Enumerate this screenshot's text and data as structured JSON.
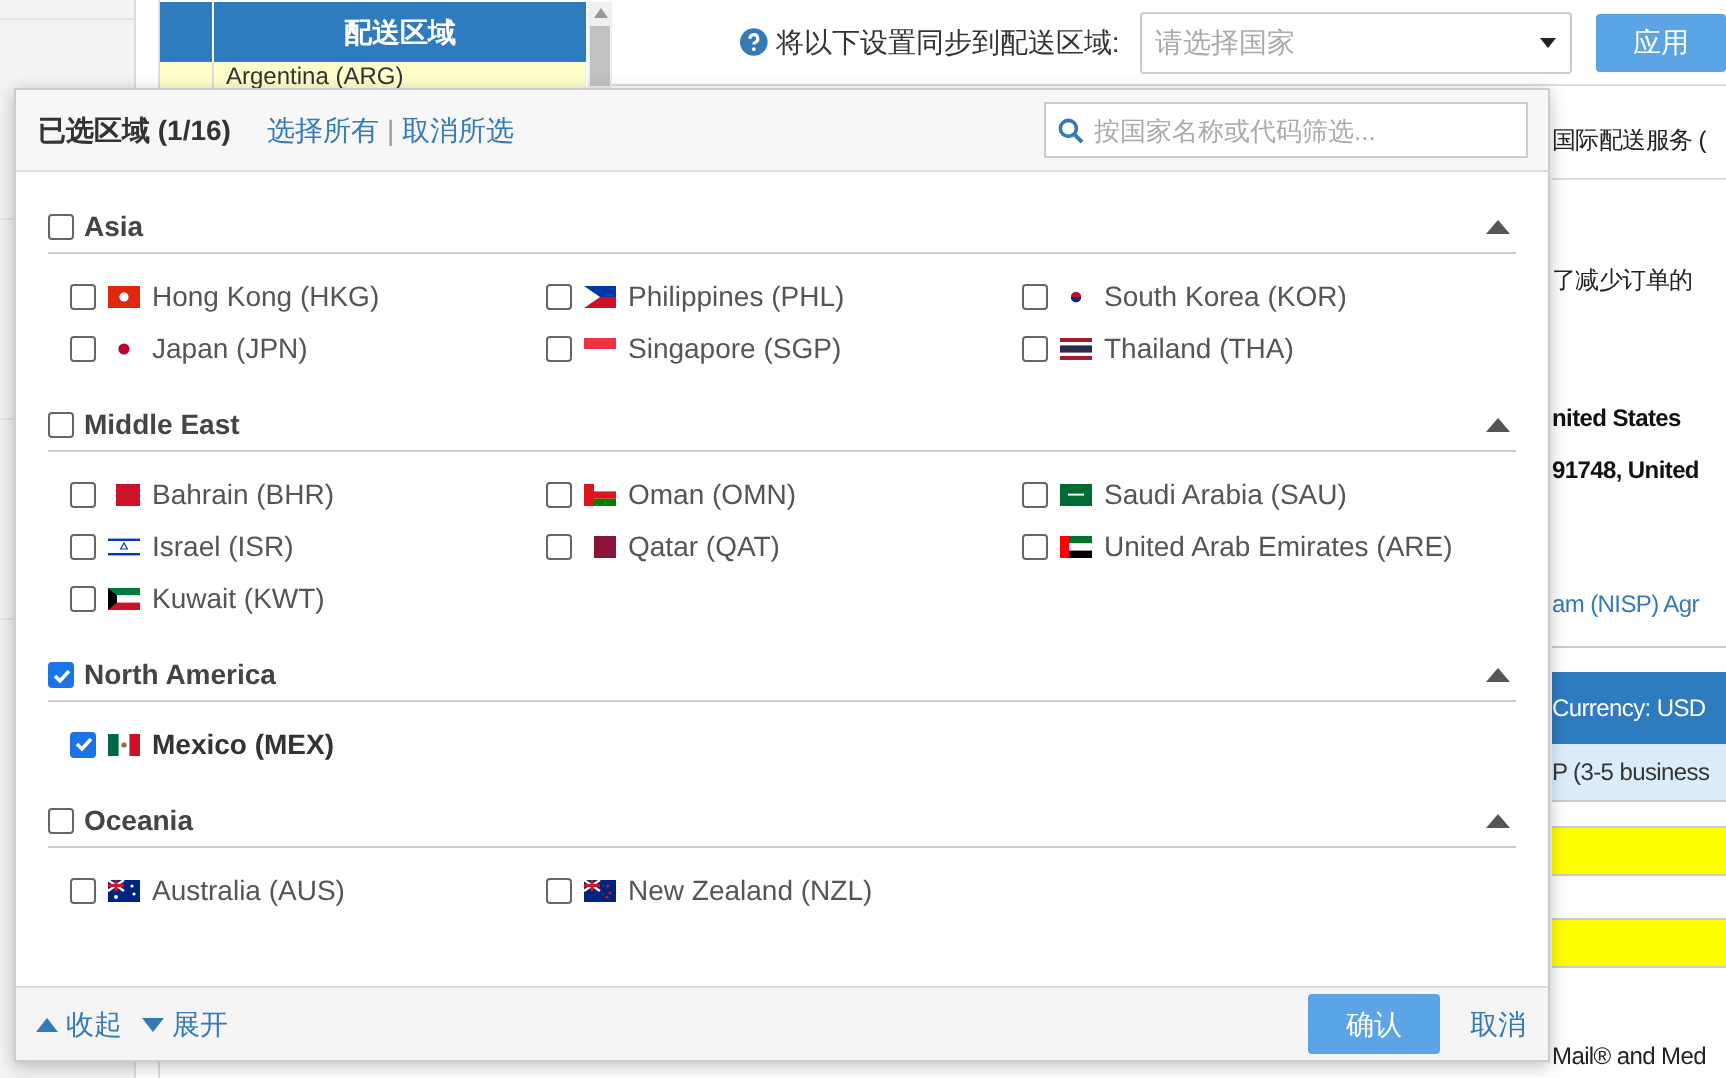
{
  "page": {
    "table_header": "配送区域",
    "table_row": "Argentina (ARG)",
    "sync_label": "将以下设置同步到配送区域:",
    "country_select": {
      "placeholder": "请选择国家"
    },
    "apply_button": "应用",
    "right_items": [
      {
        "kind": "text",
        "text": "国际配送服务 ("
      },
      {
        "kind": "text",
        "text": "了减少订单的"
      },
      {
        "kind": "bold",
        "text": "nited States"
      },
      {
        "kind": "bold",
        "text": "91748, United"
      },
      {
        "kind": "link",
        "text": "am (NISP) Agr"
      },
      {
        "kind": "header_bar",
        "text": "Currency: USD"
      },
      {
        "kind": "row",
        "text": "P (3-5 business"
      },
      {
        "kind": "highlight"
      },
      {
        "kind": "highlight"
      },
      {
        "kind": "text",
        "text": "Mail® and Med"
      }
    ]
  },
  "dialog": {
    "title": "已选区域 (1/16)",
    "select_all": "选择所有",
    "separator": "|",
    "deselect_all": "取消所选",
    "search": {
      "placeholder": "按国家名称或代码筛选..."
    },
    "groups": [
      {
        "name": "Asia",
        "checked": false,
        "expanded": true,
        "countries": [
          {
            "name": "Hong Kong (HKG)",
            "checked": false
          },
          {
            "name": "Philippines (PHL)",
            "checked": false
          },
          {
            "name": "South Korea (KOR)",
            "checked": false
          },
          {
            "name": "Japan (JPN)",
            "checked": false
          },
          {
            "name": "Singapore (SGP)",
            "checked": false
          },
          {
            "name": "Thailand (THA)",
            "checked": false
          }
        ]
      },
      {
        "name": "Middle East",
        "checked": false,
        "expanded": true,
        "countries": [
          {
            "name": "Bahrain (BHR)",
            "checked": false
          },
          {
            "name": "Oman (OMN)",
            "checked": false
          },
          {
            "name": "Saudi Arabia (SAU)",
            "checked": false
          },
          {
            "name": "Israel (ISR)",
            "checked": false
          },
          {
            "name": "Qatar (QAT)",
            "checked": false
          },
          {
            "name": "United Arab Emirates (ARE)",
            "checked": false
          },
          {
            "name": "Kuwait (KWT)",
            "checked": false
          }
        ]
      },
      {
        "name": "North America",
        "checked": true,
        "expanded": true,
        "countries": [
          {
            "name": "Mexico (MEX)",
            "checked": true
          }
        ]
      },
      {
        "name": "Oceania",
        "checked": false,
        "expanded": true,
        "countries": [
          {
            "name": "Australia (AUS)",
            "checked": false
          },
          {
            "name": "New Zealand (NZL)",
            "checked": false
          }
        ]
      }
    ],
    "collapse_all": "收起",
    "expand_all": "展开",
    "confirm_button": "确认",
    "cancel_button": "取消"
  }
}
